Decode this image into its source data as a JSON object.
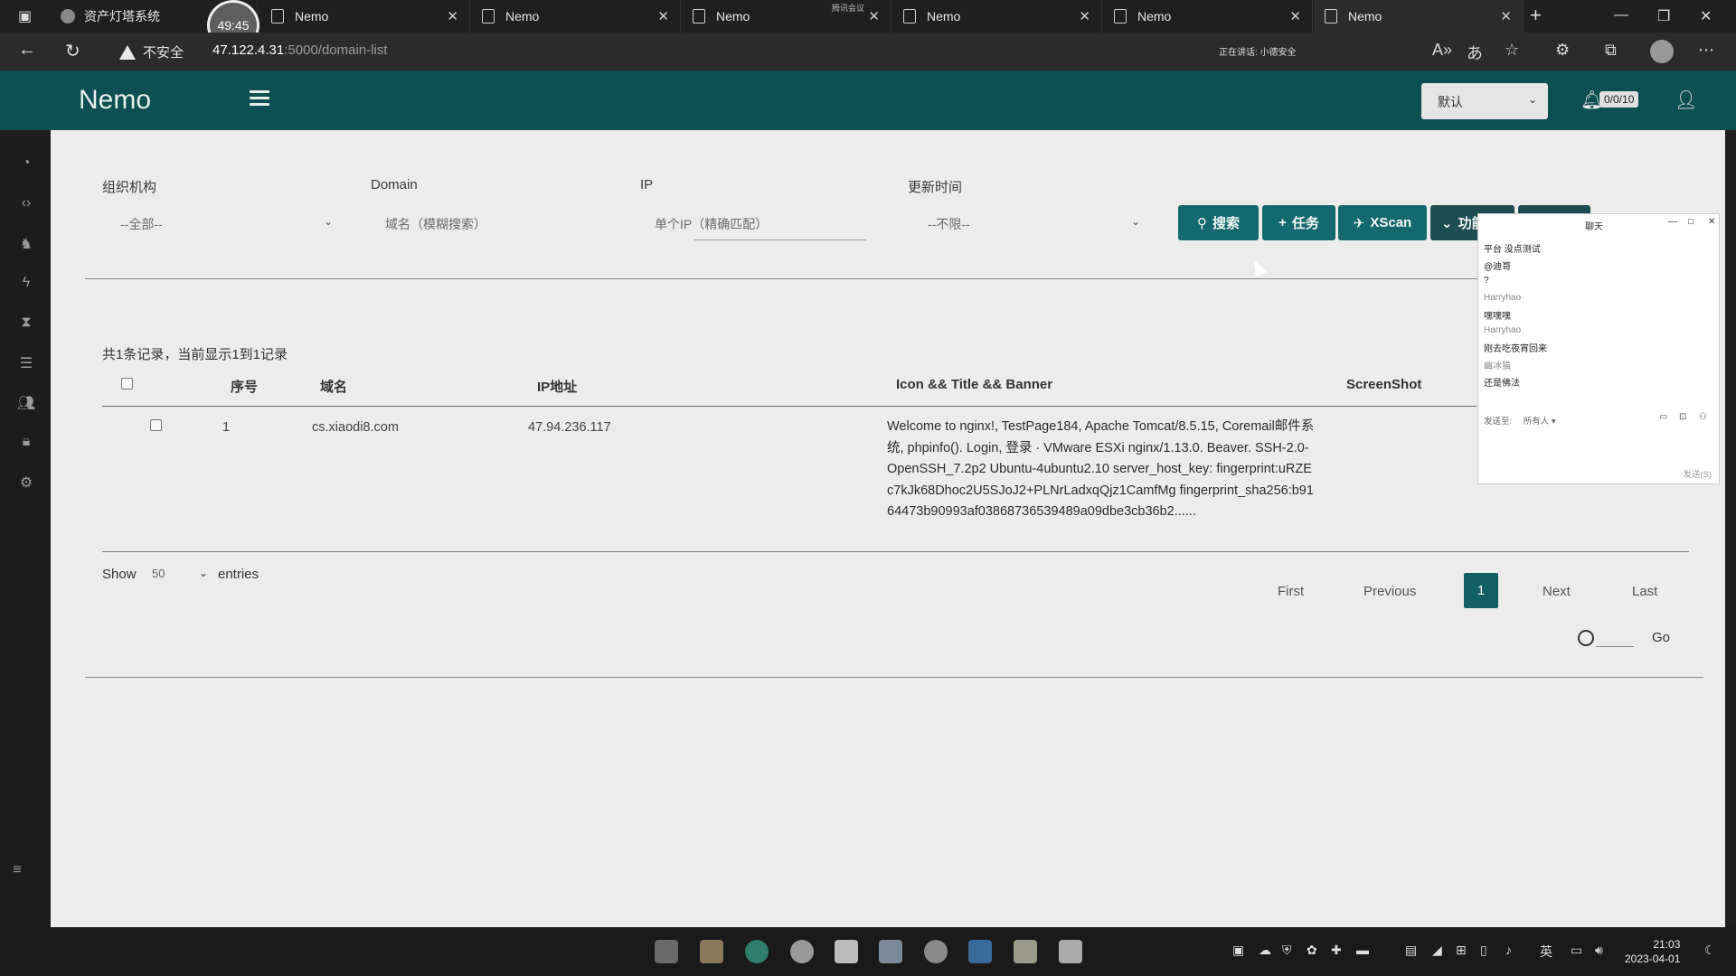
{
  "browser": {
    "tabs": [
      {
        "title": "资产灯塔系统"
      },
      {
        "title": "Nemo"
      },
      {
        "title": "Nemo"
      },
      {
        "title": "Nemo"
      },
      {
        "title": "Nemo"
      },
      {
        "title": "Nemo"
      },
      {
        "title": "Nemo"
      }
    ],
    "recording_time": "49:45",
    "meeting_tag": "腾讯会议",
    "speaking_status": "正在讲话: 小德安全",
    "security_label": "不安全",
    "url_host": "47.122.4.31",
    "url_path": ":5000/domain-list"
  },
  "header": {
    "brand": "Nemo",
    "org_select": "默认",
    "task_badge": "0/0/10"
  },
  "filters": {
    "org_label": "组织机构",
    "org_value": "--全部--",
    "domain_label": "Domain",
    "domain_placeholder": "域名（模糊搜索）",
    "ip_label": "IP",
    "ip_placeholder": "单个IP（精确匹配）",
    "updated_label": "更新时间",
    "updated_value": "--不限--"
  },
  "buttons": {
    "search": "搜索",
    "task": "任务",
    "xscan": "XScan",
    "func": "功能"
  },
  "summary": "共1条记录，当前显示1到1记录",
  "table": {
    "headers": [
      "序号",
      "域名",
      "IP地址",
      "Icon && Title && Banner",
      "ScreenShot"
    ],
    "rows": [
      {
        "index": "1",
        "domain": "cs.xiaodi8.com",
        "ip": "47.94.236.117",
        "banner": "Welcome to nginx!, TestPage184, Apache Tomcat/8.5.15, Coremail邮件系统, phpinfo(). Login, 登录 · VMware ESXi nginx/1.13.0. Beaver. SSH-2.0-OpenSSH_7.2p2 Ubuntu-4ubuntu2.10 server_host_key: fingerprint:uRZEc7kJk68Dhoc2U5SJoJ2+PLNrLadxqQjz1CamfMg fingerprint_sha256:b9164473b90993af03868736539489a09dbe3cb36b2......"
      }
    ]
  },
  "length_menu": {
    "show": "Show",
    "value": "50",
    "entries": "entries"
  },
  "pagination": {
    "first": "First",
    "previous": "Previous",
    "current": "1",
    "next": "Next",
    "last": "Last",
    "go": "Go"
  },
  "chat": {
    "title": "聊天",
    "messages": [
      {
        "text": "平台 没点测试",
        "type": "text"
      },
      {
        "text": "@迪哥",
        "type": "text"
      },
      {
        "text": "?",
        "type": "text"
      },
      {
        "text": "Harryhao",
        "type": "sender"
      },
      {
        "text": "嘿嘿嘿",
        "type": "text"
      },
      {
        "text": "Harryhao",
        "type": "sender"
      },
      {
        "text": "刚去吃夜宵回来",
        "type": "text"
      },
      {
        "text": "幽冰猫",
        "type": "sender"
      },
      {
        "text": "还是佛法",
        "type": "text"
      }
    ],
    "send_to": "发送至:",
    "send_to_value": "所有人 ▾",
    "send_label": "发送(S)"
  },
  "taskbar": {
    "ime": "英",
    "time": "21:03",
    "date": "2023-04-01"
  },
  "colors": {
    "header": "#0d4f52",
    "button": "#14696e",
    "page_active": "#0f5f63"
  }
}
